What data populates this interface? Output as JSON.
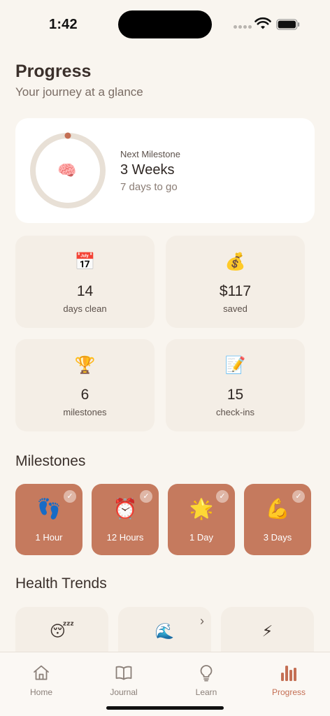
{
  "status": {
    "time": "1:42"
  },
  "header": {
    "title": "Progress",
    "subtitle": "Your journey at a glance"
  },
  "next_milestone": {
    "label": "Next Milestone",
    "value": "3 Weeks",
    "sub": "7 days to go",
    "icon": "🧠",
    "progress": 0.0,
    "colors": {
      "track": "#e8e0d6",
      "marker": "#c46f54"
    }
  },
  "stats": [
    {
      "icon": "📅",
      "value": "14",
      "label": "days clean"
    },
    {
      "icon": "💰",
      "value": "$117",
      "label": "saved"
    },
    {
      "icon": "🏆",
      "value": "6",
      "label": "milestones"
    },
    {
      "icon": "📝",
      "value": "15",
      "label": "check-ins"
    }
  ],
  "milestones": {
    "title": "Milestones",
    "items": [
      {
        "icon": "👣",
        "label": "1 Hour",
        "check": "✓"
      },
      {
        "icon": "⏰",
        "label": "12 Hours",
        "check": "✓"
      },
      {
        "icon": "🌟",
        "label": "1 Day",
        "check": "✓"
      },
      {
        "icon": "💪",
        "label": "3 Days",
        "check": "✓"
      }
    ]
  },
  "health_trends": {
    "title": "Health Trends",
    "items": [
      {
        "icon": "😴"
      },
      {
        "icon": "🌊",
        "chevron": "›"
      },
      {
        "icon": "⚡"
      }
    ]
  },
  "tabs": [
    {
      "label": "Home",
      "icon": "home-icon"
    },
    {
      "label": "Journal",
      "icon": "book-icon"
    },
    {
      "label": "Learn",
      "icon": "lightbulb-icon"
    },
    {
      "label": "Progress",
      "icon": "bar-chart-icon",
      "active": true
    }
  ],
  "colors": {
    "accent": "#c46f54",
    "tile": "#c57a5e",
    "background": "#f9f5ef",
    "card": "#f4eee6"
  }
}
